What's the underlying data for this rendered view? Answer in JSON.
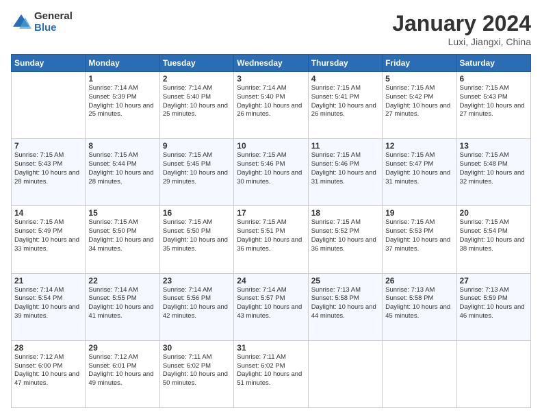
{
  "logo": {
    "general": "General",
    "blue": "Blue"
  },
  "header": {
    "month": "January 2024",
    "location": "Luxi, Jiangxi, China"
  },
  "weekdays": [
    "Sunday",
    "Monday",
    "Tuesday",
    "Wednesday",
    "Thursday",
    "Friday",
    "Saturday"
  ],
  "weeks": [
    [
      {
        "day": "",
        "sunrise": "",
        "sunset": "",
        "daylight": ""
      },
      {
        "day": "1",
        "sunrise": "7:14 AM",
        "sunset": "5:39 PM",
        "daylight": "10 hours and 25 minutes."
      },
      {
        "day": "2",
        "sunrise": "7:14 AM",
        "sunset": "5:40 PM",
        "daylight": "10 hours and 25 minutes."
      },
      {
        "day": "3",
        "sunrise": "7:14 AM",
        "sunset": "5:40 PM",
        "daylight": "10 hours and 26 minutes."
      },
      {
        "day": "4",
        "sunrise": "7:15 AM",
        "sunset": "5:41 PM",
        "daylight": "10 hours and 26 minutes."
      },
      {
        "day": "5",
        "sunrise": "7:15 AM",
        "sunset": "5:42 PM",
        "daylight": "10 hours and 27 minutes."
      },
      {
        "day": "6",
        "sunrise": "7:15 AM",
        "sunset": "5:43 PM",
        "daylight": "10 hours and 27 minutes."
      }
    ],
    [
      {
        "day": "7",
        "sunrise": "7:15 AM",
        "sunset": "5:43 PM",
        "daylight": "10 hours and 28 minutes."
      },
      {
        "day": "8",
        "sunrise": "7:15 AM",
        "sunset": "5:44 PM",
        "daylight": "10 hours and 28 minutes."
      },
      {
        "day": "9",
        "sunrise": "7:15 AM",
        "sunset": "5:45 PM",
        "daylight": "10 hours and 29 minutes."
      },
      {
        "day": "10",
        "sunrise": "7:15 AM",
        "sunset": "5:46 PM",
        "daylight": "10 hours and 30 minutes."
      },
      {
        "day": "11",
        "sunrise": "7:15 AM",
        "sunset": "5:46 PM",
        "daylight": "10 hours and 31 minutes."
      },
      {
        "day": "12",
        "sunrise": "7:15 AM",
        "sunset": "5:47 PM",
        "daylight": "10 hours and 31 minutes."
      },
      {
        "day": "13",
        "sunrise": "7:15 AM",
        "sunset": "5:48 PM",
        "daylight": "10 hours and 32 minutes."
      }
    ],
    [
      {
        "day": "14",
        "sunrise": "7:15 AM",
        "sunset": "5:49 PM",
        "daylight": "10 hours and 33 minutes."
      },
      {
        "day": "15",
        "sunrise": "7:15 AM",
        "sunset": "5:50 PM",
        "daylight": "10 hours and 34 minutes."
      },
      {
        "day": "16",
        "sunrise": "7:15 AM",
        "sunset": "5:50 PM",
        "daylight": "10 hours and 35 minutes."
      },
      {
        "day": "17",
        "sunrise": "7:15 AM",
        "sunset": "5:51 PM",
        "daylight": "10 hours and 36 minutes."
      },
      {
        "day": "18",
        "sunrise": "7:15 AM",
        "sunset": "5:52 PM",
        "daylight": "10 hours and 36 minutes."
      },
      {
        "day": "19",
        "sunrise": "7:15 AM",
        "sunset": "5:53 PM",
        "daylight": "10 hours and 37 minutes."
      },
      {
        "day": "20",
        "sunrise": "7:15 AM",
        "sunset": "5:54 PM",
        "daylight": "10 hours and 38 minutes."
      }
    ],
    [
      {
        "day": "21",
        "sunrise": "7:14 AM",
        "sunset": "5:54 PM",
        "daylight": "10 hours and 39 minutes."
      },
      {
        "day": "22",
        "sunrise": "7:14 AM",
        "sunset": "5:55 PM",
        "daylight": "10 hours and 41 minutes."
      },
      {
        "day": "23",
        "sunrise": "7:14 AM",
        "sunset": "5:56 PM",
        "daylight": "10 hours and 42 minutes."
      },
      {
        "day": "24",
        "sunrise": "7:14 AM",
        "sunset": "5:57 PM",
        "daylight": "10 hours and 43 minutes."
      },
      {
        "day": "25",
        "sunrise": "7:13 AM",
        "sunset": "5:58 PM",
        "daylight": "10 hours and 44 minutes."
      },
      {
        "day": "26",
        "sunrise": "7:13 AM",
        "sunset": "5:58 PM",
        "daylight": "10 hours and 45 minutes."
      },
      {
        "day": "27",
        "sunrise": "7:13 AM",
        "sunset": "5:59 PM",
        "daylight": "10 hours and 46 minutes."
      }
    ],
    [
      {
        "day": "28",
        "sunrise": "7:12 AM",
        "sunset": "6:00 PM",
        "daylight": "10 hours and 47 minutes."
      },
      {
        "day": "29",
        "sunrise": "7:12 AM",
        "sunset": "6:01 PM",
        "daylight": "10 hours and 49 minutes."
      },
      {
        "day": "30",
        "sunrise": "7:11 AM",
        "sunset": "6:02 PM",
        "daylight": "10 hours and 50 minutes."
      },
      {
        "day": "31",
        "sunrise": "7:11 AM",
        "sunset": "6:02 PM",
        "daylight": "10 hours and 51 minutes."
      },
      {
        "day": "",
        "sunrise": "",
        "sunset": "",
        "daylight": ""
      },
      {
        "day": "",
        "sunrise": "",
        "sunset": "",
        "daylight": ""
      },
      {
        "day": "",
        "sunrise": "",
        "sunset": "",
        "daylight": ""
      }
    ]
  ]
}
